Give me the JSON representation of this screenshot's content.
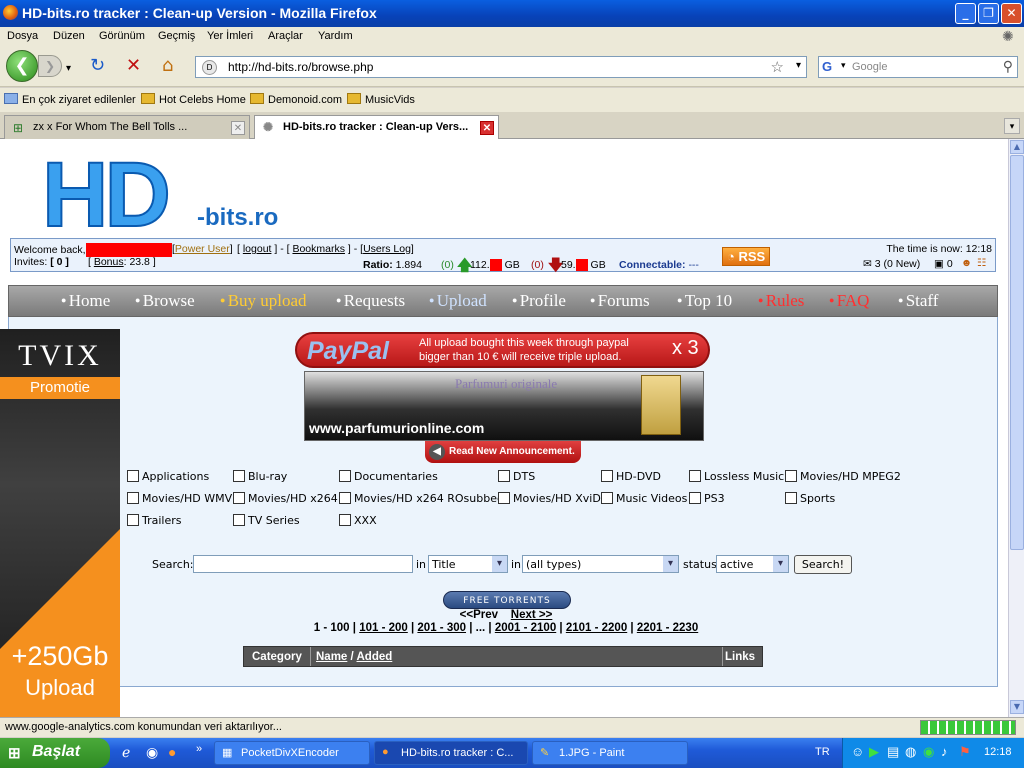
{
  "window": {
    "title": "HD-bits.ro tracker : Clean-up Version - Mozilla Firefox"
  },
  "menu": [
    "Dosya",
    "Düzen",
    "Görünüm",
    "Geçmiş",
    "Yer İmleri",
    "Araçlar",
    "Yardım"
  ],
  "navbar": {
    "url": "http://hd-bits.ro/browse.php",
    "search_placeholder": "Google"
  },
  "bookmarks": [
    "En çok ziyaret edilenler",
    "Hot Celebs Home",
    "Demonoid.com",
    "MusicVids"
  ],
  "tabs": [
    {
      "label": "zx x For Whom The Bell Tolls ...",
      "active": false
    },
    {
      "label": "HD-bits.ro tracker : Clean-up Vers...",
      "active": true
    }
  ],
  "site": {
    "logo_hd": "HD",
    "logo_suffix": "-bits.ro",
    "user": {
      "welcome": "Welcome back,",
      "class": "Power User",
      "logout": "logout",
      "bookmarks": "Bookmarks",
      "users_log": "Users Log",
      "invites_label": "Invites:",
      "invites": "[ 0 ]",
      "bonus_label": "Bonus",
      "bonus": ": 23.8 ]",
      "ratio_label": "Ratio:",
      "ratio": "1.894",
      "up_count": "(0)",
      "up_value": "112.",
      "down_count": "(0)",
      "down_value": "59.",
      "unit": "GB",
      "connectable_label": "Connectable:",
      "connectable": "---",
      "time_label": "The time is now: 12:18",
      "messages": "3 (0 New)",
      "other_count": "0",
      "rss": "RSS"
    },
    "nav": [
      "Home",
      "Browse",
      "Buy upload",
      "Requests",
      "Upload",
      "Profile",
      "Forums",
      "Top 10",
      "Rules",
      "FAQ",
      "Staff"
    ],
    "side_ad": {
      "brand": "TVIX",
      "promo": "Promotie",
      "amount": "+250Gb",
      "label": "Upload"
    },
    "paypal": {
      "brand": "PayPal",
      "line1": "All upload bought this week through paypal",
      "line2": "bigger than 10 € will receive triple upload.",
      "mult": "x 3"
    },
    "parfum": {
      "title": "Parfumuri originale",
      "url": "www.parfumurionline.com"
    },
    "announcement": "Read New Announcement.",
    "categories": [
      "Applications",
      "Blu-ray",
      "Documentaries",
      "DTS",
      "HD-DVD",
      "Lossless Music",
      "Movies/HD MPEG2",
      "Movies/HD WMV",
      "Movies/HD x264",
      "Movies/HD x264 ROsubbed",
      "Movies/HD XviD",
      "Music Videos",
      "PS3",
      "Sports",
      "Trailers",
      "TV Series",
      "XXX"
    ],
    "search": {
      "label": "Search:",
      "in": "in",
      "field": "Title",
      "types": "(all types)",
      "status_label": "status",
      "status": "active",
      "button": "Search!"
    },
    "free_torrents": "FREE TORRENTS",
    "pager": {
      "prev": "<<Prev",
      "next": "Next >>",
      "pages": [
        "1 - 100",
        "101 - 200",
        "201 - 300",
        "...",
        "2001 - 2100",
        "2101 - 2200",
        "2201 - 2230"
      ]
    },
    "table": {
      "category": "Category",
      "name": "Name",
      "added": "Added",
      "links": "Links"
    }
  },
  "status": "www.google-analytics.com konumundan veri aktarılıyor...",
  "taskbar": {
    "start": "Başlat",
    "tasks": [
      "PocketDivXEncoder",
      "HD-bits.ro tracker : C...",
      "1.JPG - Paint"
    ],
    "lang": "TR",
    "clock": "12:18"
  }
}
